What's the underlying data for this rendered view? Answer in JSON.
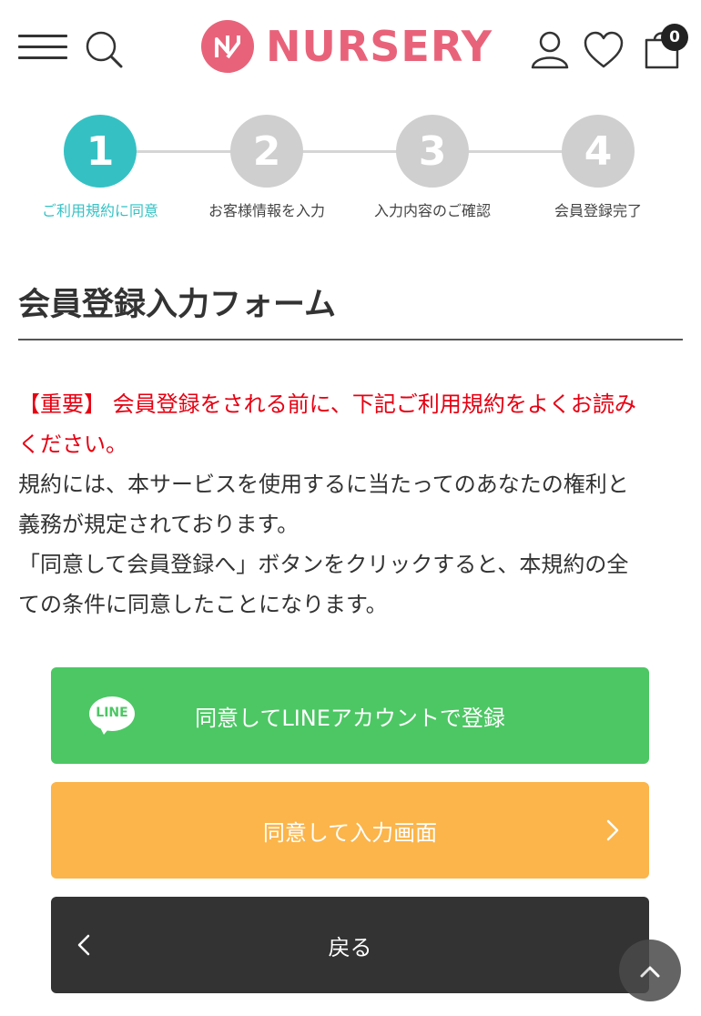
{
  "header": {
    "logo_text": "NURSERY",
    "cart_count": "0",
    "icons": [
      "menu-icon",
      "search-icon",
      "user-icon",
      "heart-icon",
      "cart-icon"
    ],
    "brand_color": "#e8637a"
  },
  "steps": [
    {
      "number": "1",
      "label": "ご利用規約に同意",
      "state": "active"
    },
    {
      "number": "2",
      "label": "お客様情報を入力",
      "state": "inactive"
    },
    {
      "number": "3",
      "label": "入力内容のご確認",
      "state": "inactive"
    },
    {
      "number": "4",
      "label": "会員登録完了",
      "state": "inactive"
    }
  ],
  "page_title": "会員登録入力フォーム",
  "notice": {
    "important_line1": "【重要】 会員登録をされる前に、下記ご利用規約をよくお読み",
    "important_line2": "ください。",
    "body_lines": [
      "規約には、本サービスを使用するに当たってのあなたの権利と",
      "義務が規定されております。",
      "「同意して会員登録へ」ボタンをクリックすると、本規約の全",
      "ての条件に同意したことになります。"
    ]
  },
  "buttons": {
    "line_register": "同意してLINEアカウントで登録",
    "line_logo_text": "LINE",
    "agree_input": "同意して入力画面",
    "back": "戻る"
  },
  "colors": {
    "step_active": "#35c1c4",
    "step_inactive": "#cfcfcf",
    "line_green": "#4cc764",
    "orange": "#fbb54a",
    "dark": "#333333",
    "notice_red": "#e60012"
  }
}
